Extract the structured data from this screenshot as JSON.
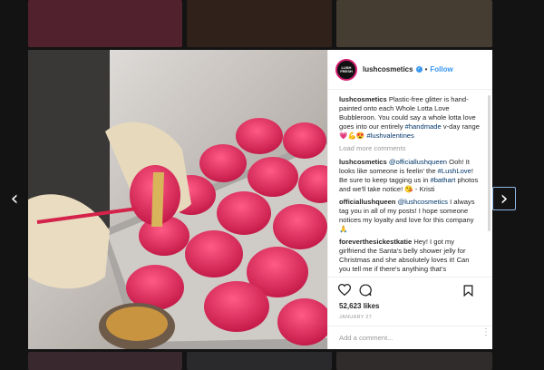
{
  "navigation": {
    "prev_glyph": "‹",
    "next_glyph": "›"
  },
  "post": {
    "header": {
      "avatar_text": "LUSH\nFRESH",
      "username": "lushcosmetics",
      "verified_glyph": "✓",
      "separator": "•",
      "follow_label": "Follow"
    },
    "caption": {
      "user": "lushcosmetics",
      "text_1": " Plastic-free glitter is hand-painted onto each Whole Lotta Love Bubbleroon. You could say a whole lotta love goes into our entirely ",
      "tag_1": "#handmade",
      "text_2": " v-day range 💗💪😍 ",
      "tag_2": "#lushvalentines"
    },
    "load_more_label": "Load more comments",
    "comments": [
      {
        "user": "officiallushqueen",
        "mention": "@officiallushqueen",
        "text_1": " Ooh! It looks like someone is feelin' the ",
        "tag_1": "#LushLove",
        "text_2": "! Be sure to keep tagging us in ",
        "tag_2": "#bathart",
        "text_3": " photos and we'll take notice! 😘 - Kristi",
        "prefix_user": "lushcosmetics"
      },
      {
        "user": "officiallushqueen",
        "mention": "@lushcosmetics",
        "text": " I always tag you in all of my posts! I hope someone notices my loyalty and love for this company 🙏"
      },
      {
        "user": "foreverthesickestkatie",
        "text": " Hey! I got my girlfriend the Santa's belly shower jelly for Christmas and she absolutely loves it! Can you tell me if there's anything that's"
      }
    ],
    "likes": "52,623 likes",
    "date": "JANUARY 27",
    "add_comment_placeholder": "Add a comment...",
    "more_glyph": "⋮"
  },
  "colors": {
    "link_blue": "#3897f0",
    "hashtag_navy": "#003569",
    "avatar_ring": "#d61d72"
  },
  "icons": [
    "chevron-left-icon",
    "chevron-right-icon",
    "verified-badge-icon",
    "heart-icon",
    "comment-icon",
    "bookmark-icon",
    "more-options-icon"
  ]
}
